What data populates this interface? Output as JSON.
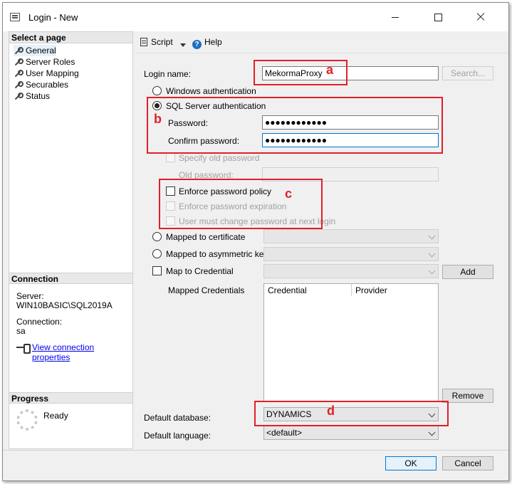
{
  "window": {
    "title": "Login - New"
  },
  "left": {
    "select_page_header": "Select a page",
    "pages": [
      "General",
      "Server Roles",
      "User Mapping",
      "Securables",
      "Status"
    ],
    "connection_header": "Connection",
    "server_label": "Server:",
    "server_value": "WIN10BASIC\\SQL2019A",
    "connection_label": "Connection:",
    "connection_value": "sa",
    "view_props_link": "View connection properties",
    "progress_header": "Progress",
    "progress_status": "Ready"
  },
  "toolbar": {
    "script_label": "Script",
    "help_label": "Help"
  },
  "form": {
    "login_name_label": "Login name:",
    "login_name_value": "MekormaProxy",
    "search_button": "Search...",
    "windows_auth": "Windows authentication",
    "sql_auth": "SQL Server authentication",
    "password_label": "Password:",
    "password_value": "●●●●●●●●●●●●",
    "confirm_label": "Confirm password:",
    "confirm_value": "●●●●●●●●●●●●",
    "specify_old": "Specify old password",
    "old_password_label": "Old password:",
    "enforce_policy": "Enforce password policy",
    "enforce_expiration": "Enforce password expiration",
    "must_change": "User must change password at next login",
    "mapped_cert": "Mapped to certificate",
    "mapped_asym": "Mapped to asymmetric key",
    "map_credential": "Map to Credential",
    "add_button": "Add",
    "mapped_credentials_label": "Mapped Credentials",
    "grid_col_credential": "Credential",
    "grid_col_provider": "Provider",
    "remove_button": "Remove",
    "default_db_label": "Default database:",
    "default_db_value": "DYNAMICS",
    "default_lang_label": "Default language:",
    "default_lang_value": "<default>"
  },
  "footer": {
    "ok_button": "OK",
    "cancel_button": "Cancel"
  },
  "annotations": {
    "a": "a",
    "b": "b",
    "c": "c",
    "d": "d"
  },
  "colors": {
    "callout": "#e0202a",
    "accent": "#0078d7"
  }
}
